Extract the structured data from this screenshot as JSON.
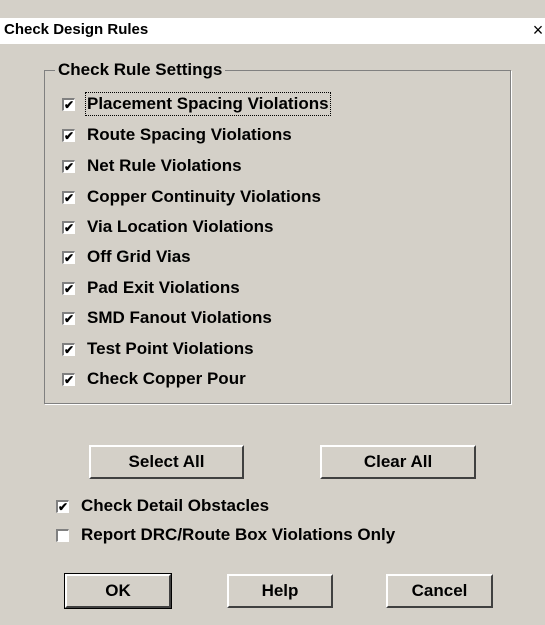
{
  "window": {
    "title": "Check Design Rules",
    "close_glyph": "×"
  },
  "group": {
    "legend": "Check Rule Settings",
    "items": [
      {
        "label": "Placement Spacing Violations",
        "checked": true
      },
      {
        "label": "Route Spacing Violations",
        "checked": true
      },
      {
        "label": "Net Rule Violations",
        "checked": true
      },
      {
        "label": "Copper Continuity Violations",
        "checked": true
      },
      {
        "label": "Via Location Violations",
        "checked": true
      },
      {
        "label": "Off Grid Vias",
        "checked": true
      },
      {
        "label": "Pad Exit Violations",
        "checked": true
      },
      {
        "label": "SMD Fanout Violations",
        "checked": true
      },
      {
        "label": "Test Point Violations",
        "checked": true
      },
      {
        "label": "Check Copper Pour",
        "checked": true
      }
    ]
  },
  "buttons": {
    "select_all": "Select All",
    "clear_all": "Clear All",
    "ok": "OK",
    "help": "Help",
    "cancel": "Cancel"
  },
  "options": [
    {
      "label": "Check Detail Obstacles",
      "checked": true
    },
    {
      "label": "Report DRC/Route Box Violations Only",
      "checked": false
    }
  ],
  "check_glyph": "✔"
}
